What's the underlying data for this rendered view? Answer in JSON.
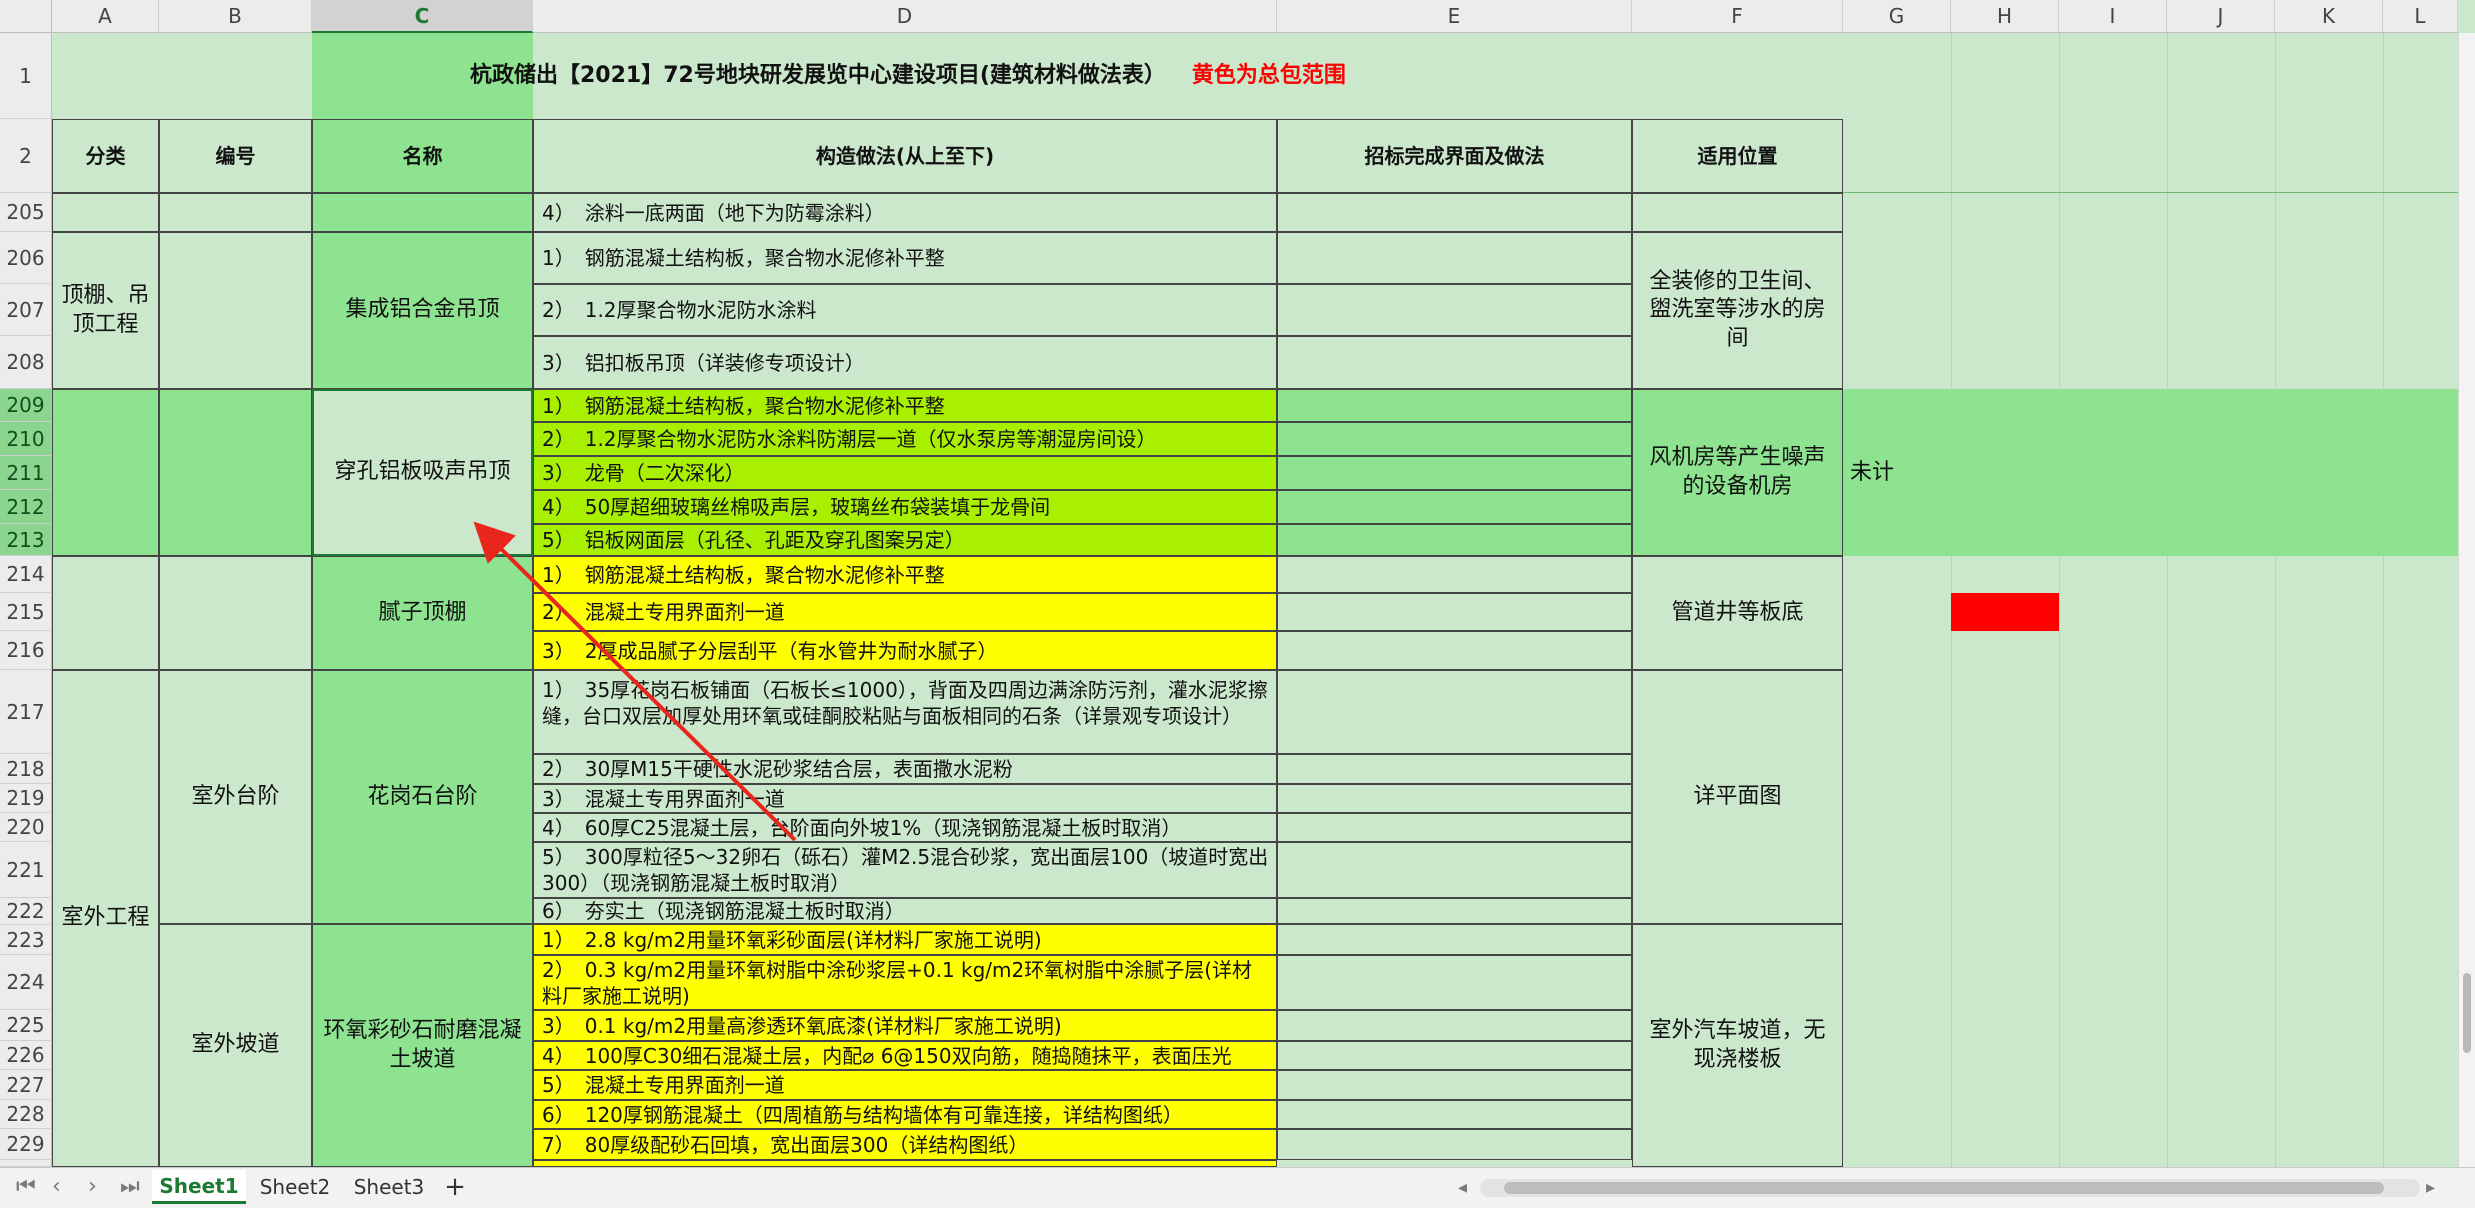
{
  "columns": [
    "A",
    "B",
    "C",
    "D",
    "E",
    "F",
    "G",
    "H",
    "I",
    "J",
    "K",
    "L"
  ],
  "selected_column": "C",
  "title": "杭政储出【2021】72号地块研发展览中心建设项目(建筑材料做法表）",
  "title_note": "黄色为总包范围",
  "headers": {
    "category": "分类",
    "code": "编号",
    "name": "名称",
    "construction": "构造做法(从上至下)",
    "bid": "招标完成界面及做法",
    "location": "适用位置"
  },
  "row_numbers": [
    "1",
    "2",
    "205",
    "206",
    "207",
    "208",
    "209",
    "210",
    "211",
    "212",
    "213",
    "214",
    "215",
    "216",
    "217",
    "218",
    "219",
    "220",
    "221",
    "222",
    "223",
    "224",
    "225",
    "226",
    "227",
    "228",
    "229"
  ],
  "cells": {
    "r205_d": "4）　涂料一底两面（地下为防霉涂料）",
    "group1_category": "顶棚、吊顶工程",
    "group1_name": "集成铝合金吊顶",
    "r206_d": "1）　钢筋混凝土结构板，聚合物水泥修补平整",
    "r207_d": "2）　1.2厚聚合物水泥防水涂料",
    "r208_d": "3）　铝扣板吊顶（详装修专项设计）",
    "group1_location": "全装修的卫生间、盥洗室等涉水的房间",
    "group2_name": "穿孔铝板吸声吊顶",
    "r209_d": "1）　钢筋混凝土结构板，聚合物水泥修补平整",
    "r210_d": "2）　1.2厚聚合物水泥防水涂料防潮层一道（仅水泵房等潮湿房间设）",
    "r211_d": "3）　龙骨（二次深化）",
    "r212_d": "4）　50厚超细玻璃丝棉吸声层，玻璃丝布袋装填于龙骨间",
    "r213_d": "5）　铝板网面层（孔径、孔距及穿孔图案另定）",
    "group2_location": "风机房等产生噪声的设备机房",
    "group2_note": "未计",
    "group3_name": "腻子顶棚",
    "r214_d": "1）　钢筋混凝土结构板，聚合物水泥修补平整",
    "r215_d": "2）　混凝土专用界面剂一道",
    "r216_d": "3）　2厚成品腻子分层刮平（有水管井为耐水腻子）",
    "group3_location": "管道井等板底",
    "group4_category": "室外工程",
    "group4_code": "室外台阶",
    "group4_name": "花岗石台阶",
    "r217_d": "1）　35厚花岗石板铺面（石板长≤1000），背面及四周边满涂防污剂，灌水泥浆擦缝，台口双层加厚处用环氧或硅酮胶粘贴与面板相同的石条（详景观专项设计）",
    "r218_d": "2）　30厚M15干硬性水泥砂浆结合层，表面撒水泥粉",
    "r219_d": "3）　混凝土专用界面剂一道",
    "r220_d": "4）　60厚C25混凝土层，台阶面向外坡1%（现浇钢筋混凝土板时取消）",
    "r221_d": "5）　300厚粒径5～32卵石（砾石）灌M2.5混合砂浆，宽出面层100（坡道时宽出300）（现浇钢筋混凝土板时取消）",
    "r222_d": "6）　夯实土（现浇钢筋混凝土板时取消）",
    "group4_location": "详平面图",
    "group5_code": "室外坡道",
    "group5_name": "环氧彩砂石耐磨混凝土坡道",
    "r223_d": "1）　2.8 kg/m2用量环氧彩砂面层(详材料厂家施工说明)",
    "r224_d": "2）　0.3 kg/m2用量环氧树脂中涂砂浆层+0.1 kg/m2环氧树脂中涂腻子层(详材料厂家施工说明)",
    "r225_d": "3）　0.1 kg/m2用量高渗透环氧底漆(详材料厂家施工说明)",
    "r226_d": "4）　100厚C30细石混凝土层，内配⌀ 6@150双向筋，随捣随抹平，表面压光",
    "r227_d": "5）　混凝土专用界面剂一道",
    "r228_d": "6）　120厚钢筋混凝土（四周植筋与结构墙体有可靠连接，详结构图纸）",
    "r229_d": "7）　80厚级配砂石回填，宽出面层300（详结构图纸）",
    "group5_location": "室外汽车坡道，无现浇楼板"
  },
  "tabs": [
    "Sheet1",
    "Sheet2",
    "Sheet3"
  ],
  "active_tab": "Sheet1",
  "add_sheet": "+",
  "colors": {
    "green_fill": "#8de38f",
    "light_green": "#cbe8cd",
    "yellow": "#ffff00",
    "lime": "#a8f000",
    "red": "#ff0000",
    "arrow": "#e8261c",
    "accent": "#1e7a32"
  }
}
